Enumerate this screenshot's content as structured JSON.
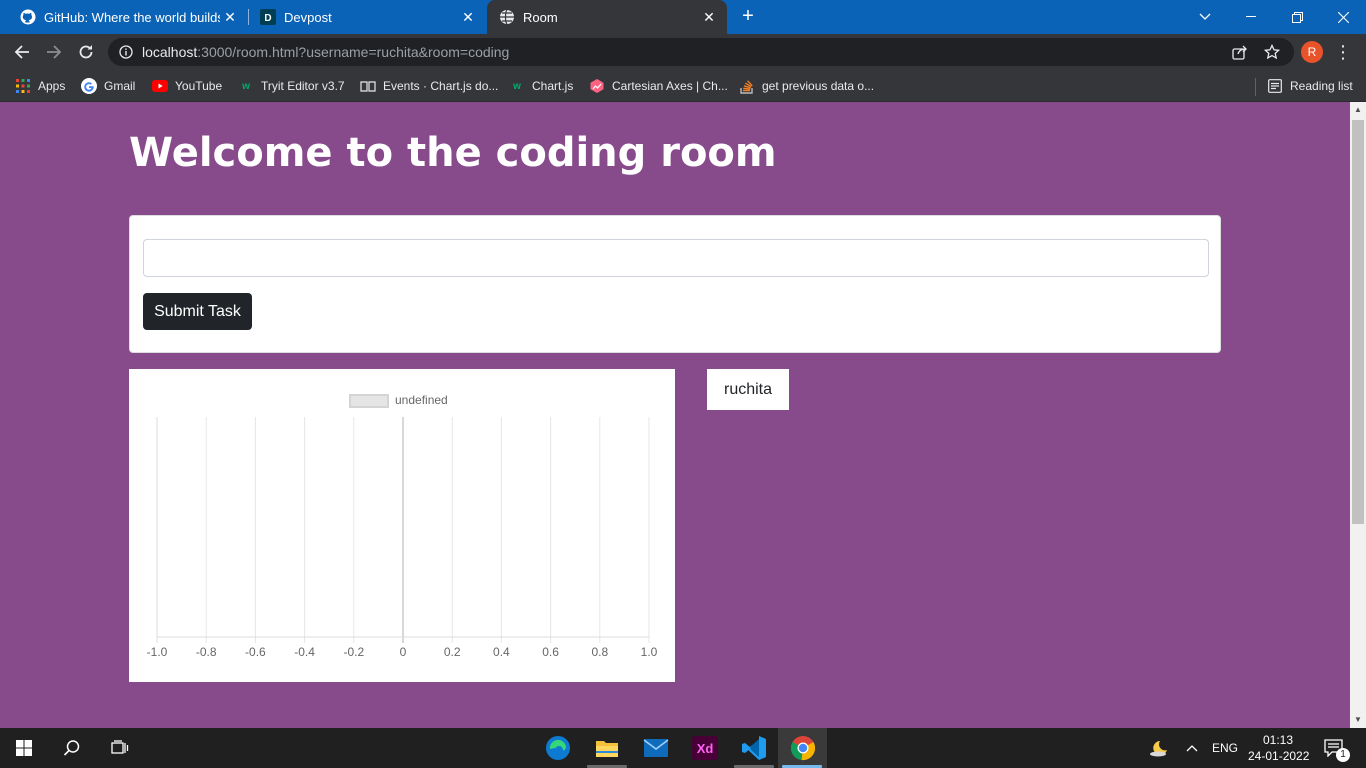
{
  "browser": {
    "tabs": [
      {
        "title": "GitHub: Where the world builds software",
        "icon": "github-icon",
        "active": false
      },
      {
        "title": "Devpost",
        "icon": "devpost-icon",
        "active": false
      },
      {
        "title": "Room",
        "icon": "globe-icon",
        "active": true
      }
    ],
    "new_tab_label": "+",
    "url_host": "localhost",
    "url_rest": ":3000/room.html?username=ruchita&room=coding",
    "profile_initial": "R",
    "bookmarks": [
      {
        "label": "Apps",
        "icon": "apps-grid-icon"
      },
      {
        "label": "Gmail",
        "icon": "google-icon"
      },
      {
        "label": "YouTube",
        "icon": "youtube-icon"
      },
      {
        "label": "Tryit Editor v3.7",
        "icon": "w3schools-icon"
      },
      {
        "label": "Events · Chart.js do...",
        "icon": "docs-icon"
      },
      {
        "label": "Chart.js",
        "icon": "w3schools-icon"
      },
      {
        "label": "Cartesian Axes | Ch...",
        "icon": "chartjs-icon"
      },
      {
        "label": "get previous data o...",
        "icon": "stackoverflow-icon"
      }
    ],
    "reading_list_label": "Reading list"
  },
  "page": {
    "heading": "Welcome to the coding room",
    "task_input_value": "",
    "submit_label": "Submit Task",
    "username": "ruchita",
    "background_color": "#874b8b"
  },
  "chart_data": {
    "type": "bar",
    "legend": [
      "undefined"
    ],
    "legend_position": "top",
    "x_ticks": [
      "-1.0",
      "-0.8",
      "-0.6",
      "-0.4",
      "-0.2",
      "0",
      "0.2",
      "0.4",
      "0.6",
      "0.8",
      "1.0"
    ],
    "xlim": [
      -1.0,
      1.0
    ],
    "series": [
      {
        "name": "undefined",
        "values": []
      }
    ],
    "grid": true
  },
  "taskbar": {
    "apps": [
      "start-icon",
      "search-icon",
      "task-view-icon",
      "edge-icon",
      "file-explorer-icon",
      "mail-icon",
      "adobe-xd-icon",
      "vscode-icon",
      "chrome-icon"
    ],
    "xd_label": "Xd",
    "language": "ENG",
    "time": "01:13",
    "date": "24-01-2022",
    "notification_count": "1"
  }
}
